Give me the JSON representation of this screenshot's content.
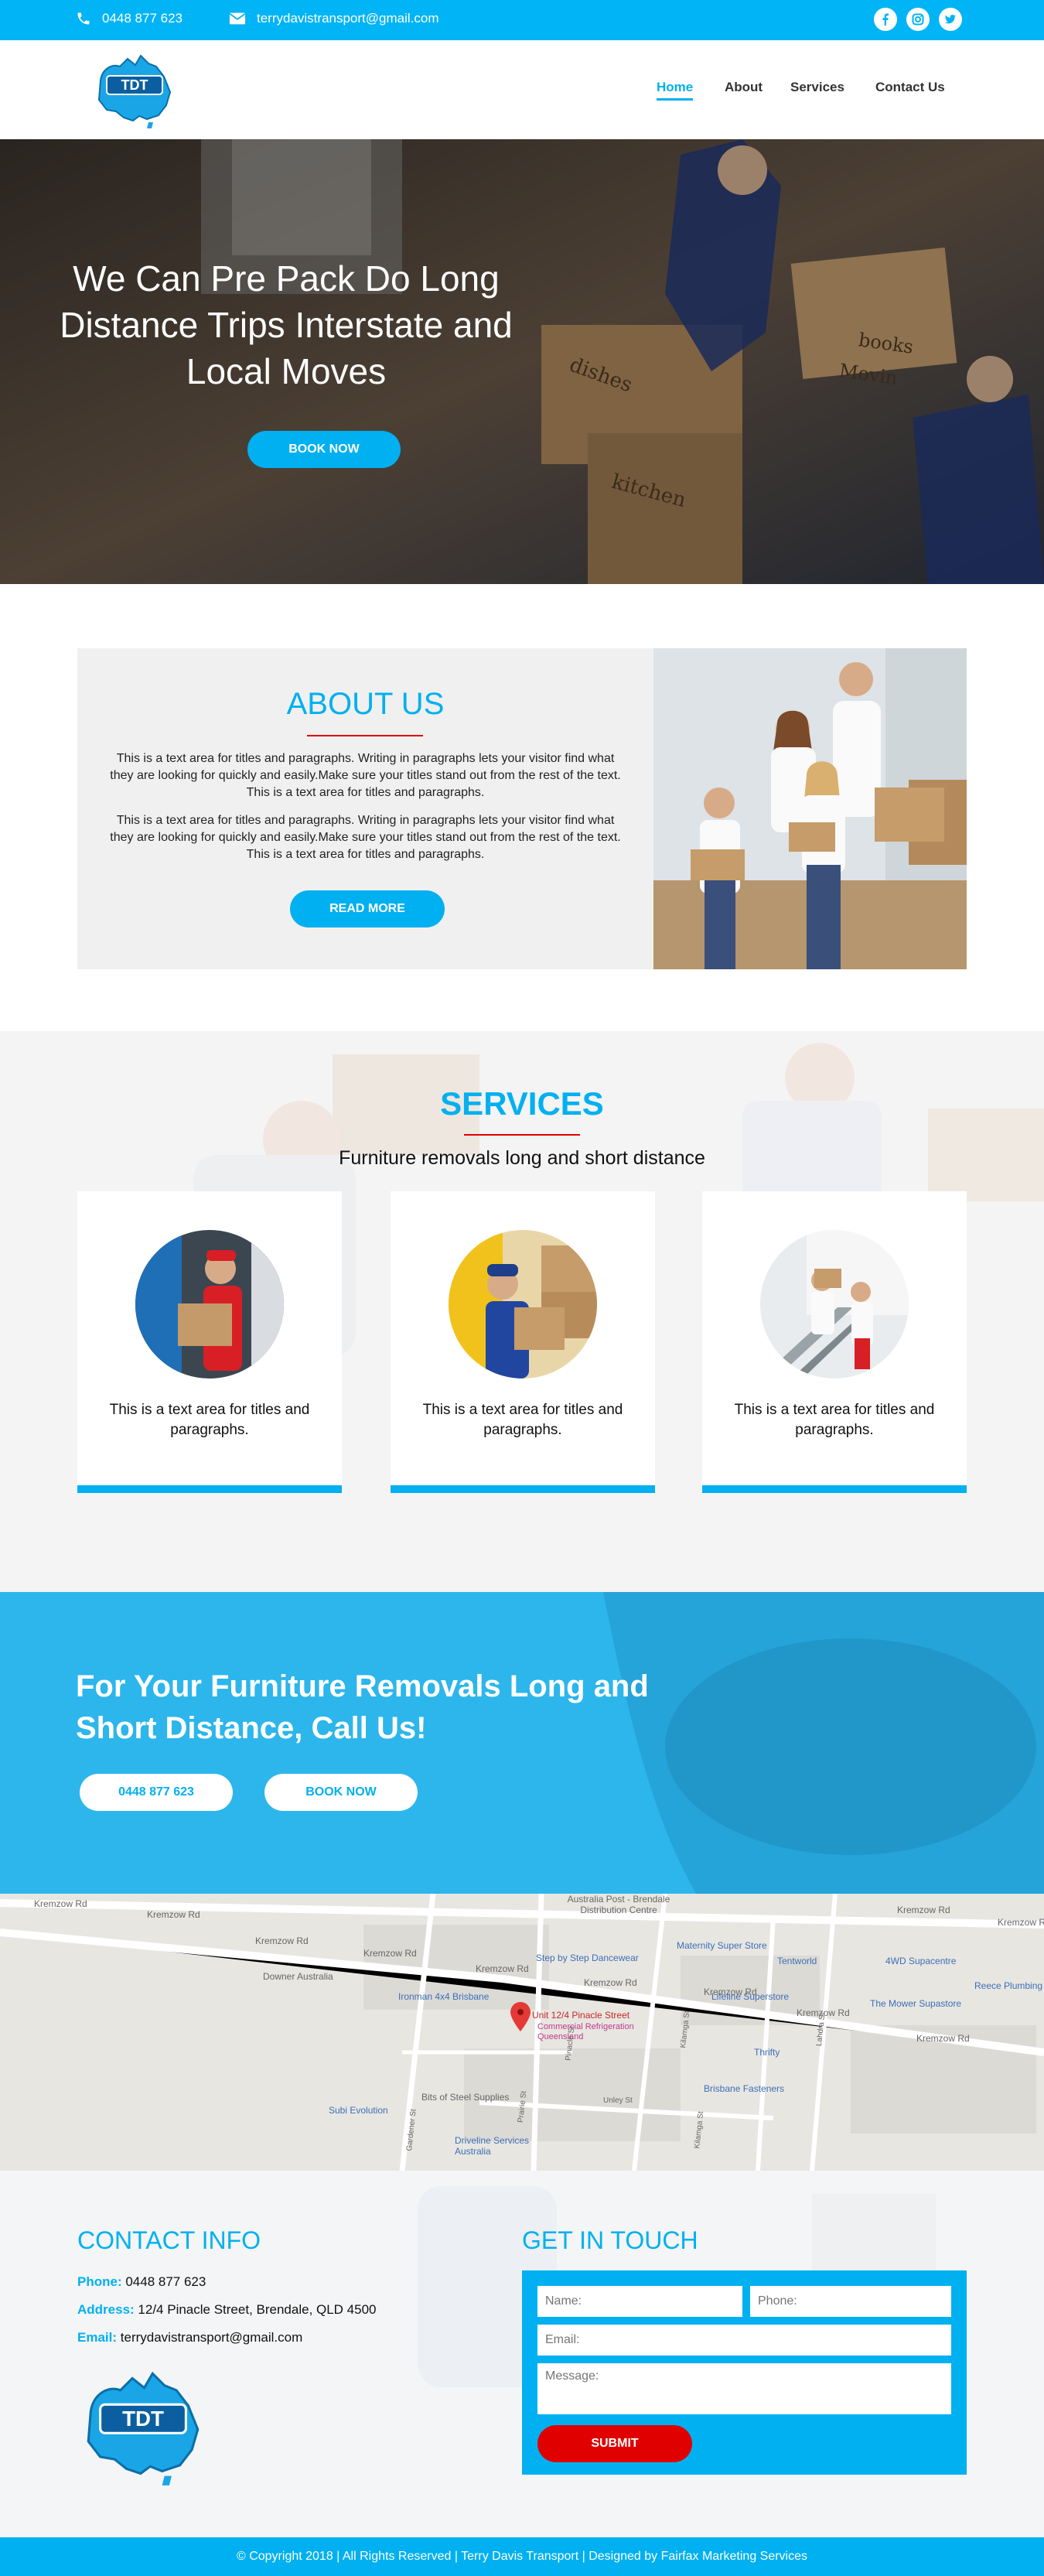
{
  "topbar": {
    "phone": "0448 877 623",
    "email": "terrydavistransport@gmail.com",
    "social": [
      "facebook-icon",
      "instagram-icon",
      "twitter-icon"
    ]
  },
  "nav": {
    "logo_text": "TDT",
    "items": [
      {
        "label": "Home",
        "active": true
      },
      {
        "label": "About",
        "active": false
      },
      {
        "label": "Services",
        "active": false
      },
      {
        "label": "Contact Us",
        "active": false
      }
    ]
  },
  "hero": {
    "title": "We Can Pre Pack Do Long Distance Trips Interstate and Local Moves",
    "button": "BOOK NOW",
    "box_labels": [
      "dishes",
      "kitchen",
      "books",
      "Movin"
    ]
  },
  "about": {
    "title": "ABOUT US",
    "paragraphs": [
      "This is a text area for titles and paragraphs. Writing in paragraphs lets your visitor find what they are looking for quickly and easily.Make sure your titles stand out from the rest of the text. This is a text area for titles and paragraphs.",
      "This is a text area for titles and paragraphs. Writing in paragraphs lets your visitor find what they are looking for quickly and easily.Make sure your titles stand out from the rest of the text. This is a text area for titles and paragraphs."
    ],
    "button": "READ MORE"
  },
  "services": {
    "title": "SERVICES",
    "subtitle": "Furniture removals long and short distance",
    "cards": [
      {
        "text": "This is a text area for titles and paragraphs."
      },
      {
        "text": "This is a text area for titles and paragraphs."
      },
      {
        "text": "This is a text area for titles and paragraphs."
      }
    ]
  },
  "cta": {
    "title": "For Your Furniture Removals Long and Short Distance, Call Us!",
    "phone_button": "0448 877 623",
    "book_button": "BOOK NOW"
  },
  "map": {
    "roads": [
      "Kremzow Rd",
      "Kremzow Rd",
      "Kremzow Rd",
      "Kremzow Rd",
      "Kremzow Rd",
      "Kremzow Rd",
      "Kremzow Rd",
      "Kremzow Rd",
      "Kremzow Rd",
      "Kremzow Rd",
      "Kremzow Rd"
    ],
    "places": [
      "Australia Post - Brendale Distribution Centre",
      "Maternity Super Store",
      "Step by Step Dancewear",
      "Tentworld",
      "4WD Supacentre",
      "Downer Australia",
      "Lifeline Superstore",
      "Reece Plumbing",
      "The Mower Supastore",
      "Ironman 4x4 Brisbane",
      "Unit 12/4 Pinacle Street",
      "Commercial Refrigeration Queensland",
      "Thrifty",
      "Brisbane Fasteners",
      "Subi Evolution",
      "Bits of Steel Supplies",
      "Driveline Services Australia"
    ],
    "small_streets": [
      "Kilamga St",
      "Lahdra St",
      "Unley St",
      "Prairie St",
      "Pinacle St",
      "Gardener St",
      "Kilamga St"
    ]
  },
  "contact": {
    "info_title": "CONTACT INFO",
    "phone_label": "Phone:",
    "phone": "0448 877 623",
    "address_label": "Address:",
    "address": "12/4 Pinacle Street, Brendale, QLD 4500",
    "email_label": "Email:",
    "email": "terrydavistransport@gmail.com",
    "form_title": "GET IN TOUCH",
    "name_placeholder": "Name:",
    "phone_placeholder": "Phone:",
    "email_placeholder": "Email:",
    "message_placeholder": "Message:",
    "submit": "SUBMIT"
  },
  "footer": {
    "text": "© Copyright 2018 | All Rights Reserved | Terry Davis Transport | Designed by Fairfax Marketing Services"
  },
  "colors": {
    "accent": "#00b0f0",
    "red": "#e00000"
  }
}
